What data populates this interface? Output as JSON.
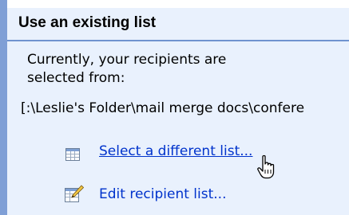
{
  "section": {
    "title": "Use an existing list",
    "description_line1": "Currently, your recipients are",
    "description_line2": "selected from:",
    "path": "[:\\Leslie's Folder\\mail merge docs\\confere"
  },
  "actions": {
    "select_label": "Select a different list...",
    "edit_label": "Edit recipient list..."
  },
  "icons": {
    "select": "table-icon",
    "edit": "edit-list-icon",
    "cursor": "hand-pointer-icon"
  },
  "colors": {
    "panel_background": "#e9f1fd",
    "rule": "#6f93cf",
    "link": "#0033cc"
  }
}
